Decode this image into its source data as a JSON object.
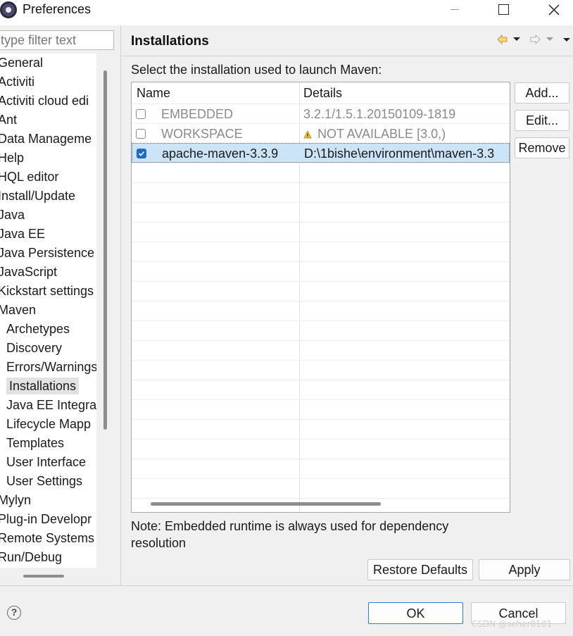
{
  "window": {
    "title": "Preferences",
    "minimize_icon": "minimize-icon",
    "maximize_icon": "maximize-icon",
    "close_icon": "close-icon"
  },
  "sidebar": {
    "filter_placeholder": "type filter text",
    "items": [
      {
        "label": "General",
        "level": 0
      },
      {
        "label": "Activiti",
        "level": 0
      },
      {
        "label": "Activiti cloud edi",
        "level": 0
      },
      {
        "label": "Ant",
        "level": 0
      },
      {
        "label": "Data Manageme",
        "level": 0
      },
      {
        "label": "Help",
        "level": 0
      },
      {
        "label": "HQL editor",
        "level": 0
      },
      {
        "label": "Install/Update",
        "level": 0
      },
      {
        "label": "Java",
        "level": 0
      },
      {
        "label": "Java EE",
        "level": 0
      },
      {
        "label": "Java Persistence",
        "level": 0
      },
      {
        "label": "JavaScript",
        "level": 0
      },
      {
        "label": "Kickstart settings",
        "level": 0
      },
      {
        "label": "Maven",
        "level": 0
      },
      {
        "label": "Archetypes",
        "level": 1
      },
      {
        "label": "Discovery",
        "level": 1
      },
      {
        "label": "Errors/Warnings",
        "level": 1
      },
      {
        "label": "Installations",
        "level": 1,
        "selected": true
      },
      {
        "label": "Java EE Integra",
        "level": 1
      },
      {
        "label": "Lifecycle Mapp",
        "level": 1
      },
      {
        "label": "Templates",
        "level": 1
      },
      {
        "label": "User Interface",
        "level": 1
      },
      {
        "label": "User Settings",
        "level": 1
      },
      {
        "label": "Mylyn",
        "level": 0
      },
      {
        "label": "Plug-in Developr",
        "level": 0
      },
      {
        "label": "Remote Systems",
        "level": 0
      },
      {
        "label": "Run/Debug",
        "level": 0
      }
    ]
  },
  "page": {
    "title": "Installations",
    "subtitle": "Select the installation used to launch Maven:",
    "nav_icons": [
      "back-arrow-icon",
      "dropdown-icon",
      "forward-arrow-icon",
      "dropdown-icon",
      "view-menu-icon"
    ]
  },
  "table": {
    "headers": [
      "Name",
      "Details"
    ],
    "rows": [
      {
        "checked": false,
        "name": "EMBEDDED",
        "details": "3.2.1/1.5.1.20150109-1819",
        "greyed": true,
        "warning": false
      },
      {
        "checked": false,
        "name": "WORKSPACE",
        "details": "NOT AVAILABLE [3.0,)",
        "greyed": true,
        "warning": true
      },
      {
        "checked": true,
        "name": "apache-maven-3.3.9",
        "details": "D:\\1bishe\\environment\\maven-3.3",
        "greyed": false,
        "warning": false,
        "selected": true
      }
    ]
  },
  "side_buttons": {
    "add": "Add...",
    "edit": "Edit...",
    "remove": "Remove"
  },
  "note": "Note: Embedded runtime is always used for dependency resolution",
  "actions": {
    "restore_defaults": "Restore Defaults",
    "apply": "Apply"
  },
  "footer": {
    "help_icon": "help-icon",
    "ok": "OK",
    "cancel": "Cancel"
  },
  "watermark": "CSDN @seher0101"
}
